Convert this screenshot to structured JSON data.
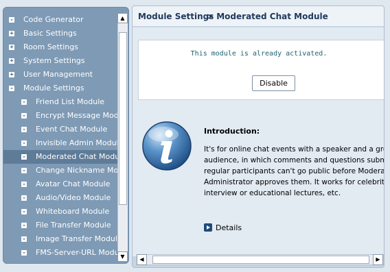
{
  "tree": {
    "items": [
      {
        "label": "Code Generator",
        "icon": "-",
        "level": 0
      },
      {
        "label": "Basic Settings",
        "icon": "+",
        "level": 0
      },
      {
        "label": "Room Settings",
        "icon": "+",
        "level": 0
      },
      {
        "label": "System Settings",
        "icon": "+",
        "level": 0
      },
      {
        "label": "User Management",
        "icon": "+",
        "level": 0
      },
      {
        "label": "Module Settings",
        "icon": "-",
        "level": 0
      },
      {
        "label": "Friend List Module",
        "icon": "-",
        "level": 1
      },
      {
        "label": "Encrypt Message Module",
        "icon": "-",
        "level": 1
      },
      {
        "label": "Event Chat Module",
        "icon": "-",
        "level": 1
      },
      {
        "label": "Invisible Admin Module",
        "icon": "-",
        "level": 1
      },
      {
        "label": "Moderated Chat Module",
        "icon": "-",
        "level": 1,
        "selected": true
      },
      {
        "label": "Change Nickname Module",
        "icon": "-",
        "level": 1
      },
      {
        "label": "Avatar Chat Module",
        "icon": "-",
        "level": 1
      },
      {
        "label": "Audio/Video Module",
        "icon": "-",
        "level": 1
      },
      {
        "label": "Whiteboard Module",
        "icon": "-",
        "level": 1
      },
      {
        "label": "File Transfer Module",
        "icon": "-",
        "level": 1
      },
      {
        "label": "Image Transfer Module",
        "icon": "-",
        "level": 1
      },
      {
        "label": "FMS-Server-URL Module",
        "icon": "-",
        "level": 1
      }
    ]
  },
  "breadcrumb": {
    "section": "Module Settings",
    "page": "> Moderated Chat Module"
  },
  "status": {
    "text": "This module is already activated.",
    "button_label": "Disable"
  },
  "intro": {
    "title": "Introduction:",
    "lines": [
      "It's for online chat events with a speaker and a group of",
      "audience, in which comments and questions submitted by",
      "regular participants can't go public before  Moderator or",
      "Administrator approves them. It works for celebrity",
      "interview or educational lectures, etc."
    ],
    "details_label": "Details",
    "info_icon": "info-icon"
  },
  "colors": {
    "sidebar_bg": "#7e9ab5",
    "selected_bg": "#5e7b98",
    "heading": "#213a5c"
  }
}
